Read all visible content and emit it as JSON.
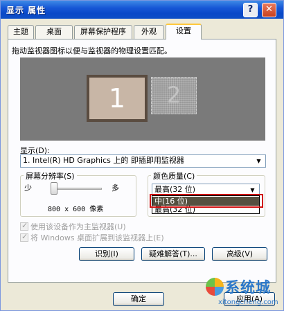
{
  "window": {
    "title": "显示 属性"
  },
  "titlebar": {
    "help_glyph": "?",
    "close_glyph": "✕"
  },
  "tabs": [
    {
      "label": "主题"
    },
    {
      "label": "桌面"
    },
    {
      "label": "屏幕保护程序"
    },
    {
      "label": "外观"
    },
    {
      "label": "设置"
    }
  ],
  "settings": {
    "instruction": "拖动监视器图标以便与监视器的物理设置匹配。",
    "monitor1_number": "1",
    "monitor2_number": "2",
    "display_label": "显示(D):",
    "display_value": "1. Intel(R) HD Graphics 上的 即插即用监视器",
    "resolution": {
      "group_label": "屏幕分辨率(S)",
      "less_label": "少",
      "more_label": "多",
      "value": "800 x 600 像素"
    },
    "color_quality": {
      "group_label": "颜色质量(C)",
      "selected_value": "最高(32 位)",
      "options": [
        "中(16 位)",
        "最高(32 位)"
      ]
    },
    "checkbox_primary": "使用该设备作为主监视器(U)",
    "checkbox_extend": "将 Windows 桌面扩展到该监视器上(E)",
    "buttons": {
      "identify": "识别(I)",
      "troubleshoot": "疑难解答(T)...",
      "advanced": "高级(V)"
    }
  },
  "footer": {
    "ok": "确定",
    "apply": "应用(A)"
  },
  "watermark": {
    "brand": "系统城",
    "url": "xitongcheng.com"
  },
  "colors": {
    "titlebar": "#0a49c8",
    "tab_highlight": "#ffc83c",
    "selected_option_bg": "#555040",
    "annotation_box": "#d01010"
  }
}
